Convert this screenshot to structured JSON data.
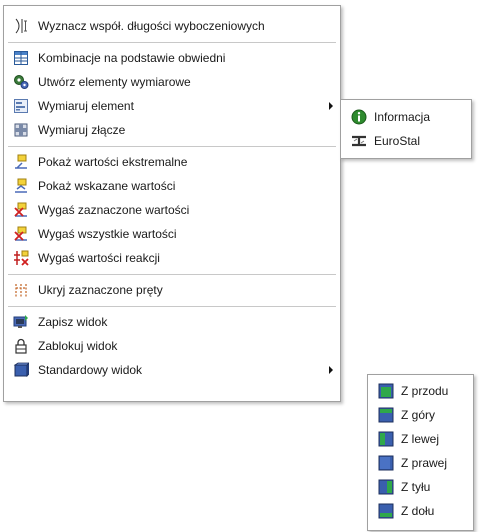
{
  "main_menu": {
    "items": [
      {
        "label": "Wyznacz współ. długości wyboczeniowych",
        "icon": "buckling-icon"
      },
      {
        "label": "Kombinacje na podstawie obwiedni",
        "icon": "table-icon"
      },
      {
        "label": "Utwórz elementy wymiarowe",
        "icon": "gears-icon"
      },
      {
        "label": "Wymiaruj element",
        "icon": "design-element-icon"
      },
      {
        "label": "Wymiaruj złącze",
        "icon": "design-joint-icon"
      },
      {
        "label": "Pokaż wartości ekstremalne",
        "icon": "extreme-values-icon"
      },
      {
        "label": "Pokaż wskazane wartości",
        "icon": "show-values-icon"
      },
      {
        "label": "Wygaś zaznaczone wartości",
        "icon": "hide-selected-values-icon"
      },
      {
        "label": "Wygaś wszystkie wartości",
        "icon": "hide-all-values-icon"
      },
      {
        "label": "Wygaś wartości reakcji",
        "icon": "hide-reactions-icon"
      },
      {
        "label": "Ukryj zaznaczone pręty",
        "icon": "hide-bars-icon"
      },
      {
        "label": "Zapisz widok",
        "icon": "save-view-icon"
      },
      {
        "label": "Zablokuj widok",
        "icon": "lock-view-icon"
      },
      {
        "label": "Standardowy widok",
        "icon": "standard-view-icon"
      }
    ]
  },
  "element_submenu": {
    "items": [
      {
        "label": "Informacja",
        "icon": "info-icon"
      },
      {
        "label": "EuroStal",
        "icon": "eurostal-icon"
      }
    ]
  },
  "view_submenu": {
    "items": [
      {
        "label": "Z przodu",
        "icon": "view-front-icon"
      },
      {
        "label": "Z góry",
        "icon": "view-top-icon"
      },
      {
        "label": "Z lewej",
        "icon": "view-left-icon"
      },
      {
        "label": "Z prawej",
        "icon": "view-right-icon"
      },
      {
        "label": "Z tyłu",
        "icon": "view-back-icon"
      },
      {
        "label": "Z dołu",
        "icon": "view-bottom-icon"
      }
    ]
  },
  "colors": {
    "cube_blue": "#3a5fae",
    "cube_green": "#2fa84a",
    "info_green": "#2e8b2e"
  }
}
